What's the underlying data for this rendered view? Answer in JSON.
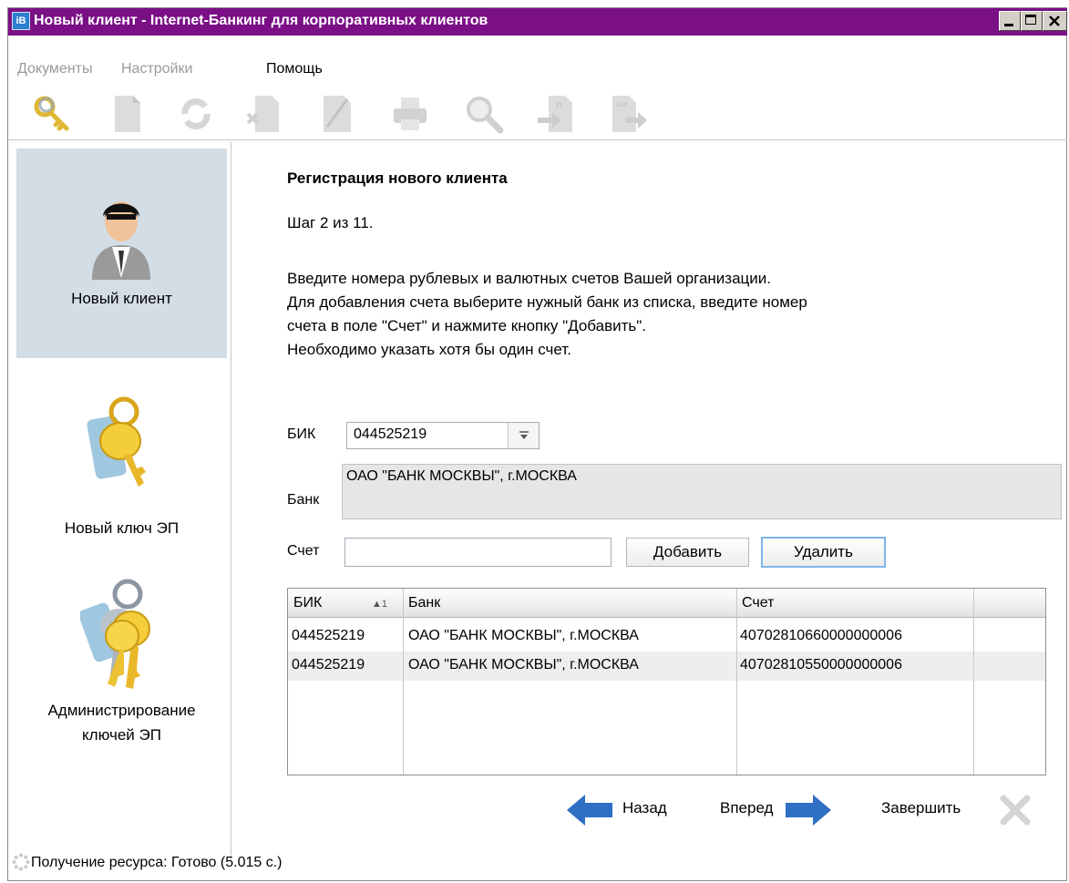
{
  "window": {
    "title": "Новый клиент - Internet-Банкинг для корпоративных клиентов",
    "icon": "app-icon"
  },
  "menu": {
    "items": [
      {
        "label": "Документы",
        "enabled": false
      },
      {
        "label": "Настройки",
        "enabled": false
      },
      {
        "label": "Помощь",
        "enabled": true
      }
    ]
  },
  "toolbar": {
    "icons": [
      "keys-icon",
      "new-document-icon",
      "refresh-icon",
      "delete-document-icon",
      "sign-document-icon",
      "print-icon",
      "search-icon",
      "import-icon",
      "export-icon"
    ]
  },
  "sidebar": {
    "items": [
      {
        "label": "Новый клиент",
        "icon": "user-icon",
        "selected": true
      },
      {
        "label": "Новый ключ ЭП",
        "icon": "key-icon",
        "selected": false
      },
      {
        "label_line1": "Администрирование",
        "label_line2": "ключей ЭП",
        "icon": "keys-bunch-icon",
        "selected": false
      }
    ]
  },
  "content": {
    "heading": "Регистрация нового клиента",
    "step": "Шаг 2 из 11.",
    "instructions": [
      "Введите номера рублевых и валютных счетов Вашей организации.",
      "Для добавления счета выберите нужный банк из списка, введите номер",
      "счета в поле \"Счет\" и нажмите кнопку \"Добавить\".",
      "Необходимо указать хотя бы один счет."
    ],
    "form": {
      "bik_label": "БИК",
      "bik_value": "044525219",
      "bank_label": "Банк",
      "bank_value": "ОАО \"БАНК МОСКВЫ\", г.МОСКВА",
      "account_label": "Счет",
      "account_value": "",
      "add_button": "Добавить",
      "delete_button": "Удалить"
    },
    "table": {
      "columns": [
        "БИК",
        "Банк",
        "Счет"
      ],
      "sort_indicator": "▲1",
      "rows": [
        {
          "bik": "044525219",
          "bank": "ОАО \"БАНК МОСКВЫ\", г.МОСКВА",
          "account": "40702810660000000006"
        },
        {
          "bik": "044525219",
          "bank": "ОАО \"БАНК МОСКВЫ\", г.МОСКВА",
          "account": "40702810550000000006"
        }
      ]
    },
    "navigation": {
      "back": "Назад",
      "next": "Вперед",
      "finish": "Завершить"
    }
  },
  "status": {
    "text": "Получение ресурса: Готово (5.015 с.)"
  },
  "colors": {
    "titlebar": "#7a0f86",
    "selected_nav": "#d3dde6",
    "arrow_blue": "#2f6fc4"
  }
}
